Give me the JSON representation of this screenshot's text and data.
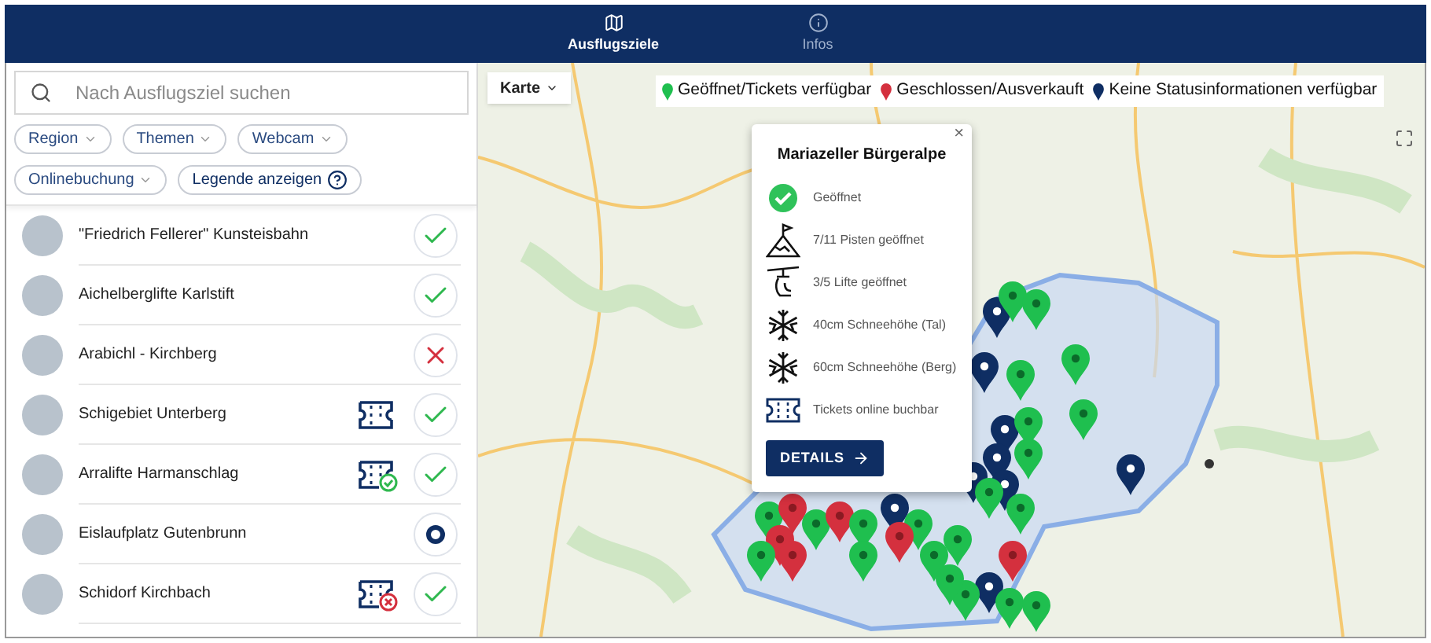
{
  "nav": {
    "tabs": [
      {
        "label": "Ausflugsziele",
        "kind": "map",
        "selected": true
      },
      {
        "label": "Infos",
        "kind": "info",
        "selected": false
      }
    ]
  },
  "search": {
    "placeholder": "Nach Ausflugsziel suchen"
  },
  "filters": [
    {
      "label": "Region",
      "kind": "dropdown"
    },
    {
      "label": "Themen",
      "kind": "dropdown"
    },
    {
      "label": "Webcam",
      "kind": "dropdown"
    },
    {
      "label": "Onlinebuchung",
      "kind": "dropdown"
    },
    {
      "label": "Legende anzeigen",
      "kind": "help"
    }
  ],
  "destinations": [
    {
      "name": "\"Friedrich Fellerer\" Kunsteisbahn",
      "status_icon": {
        "kind": "open"
      }
    },
    {
      "name": "Aichelberglifte Karlstift",
      "status_icon": {
        "kind": "open"
      }
    },
    {
      "name": "Arabichl - Kirchberg",
      "status_icon": {
        "kind": "closed"
      }
    },
    {
      "name": "Schigebiet Unterberg",
      "ticket_icon": {
        "kind": "plain"
      },
      "status_icon": {
        "kind": "open"
      }
    },
    {
      "name": "Arralifte Harmanschlag",
      "ticket_icon": {
        "kind": "available"
      },
      "status_icon": {
        "kind": "open"
      }
    },
    {
      "name": "Eislaufplatz Gutenbrunn",
      "status_icon": {
        "kind": "unknown"
      }
    },
    {
      "name": "Schidorf Kirchbach",
      "ticket_icon": {
        "kind": "sold_out"
      },
      "status_icon": {
        "kind": "open"
      }
    }
  ],
  "map": {
    "type_button": "Karte",
    "legend": [
      {
        "label": "Geöffnet/Tickets verfügbar",
        "color": "#1fbf4f"
      },
      {
        "label": "Geschlossen/Ausverkauft",
        "color": "#d4303e"
      },
      {
        "label": "Keine Statusinformationen verfügbar",
        "color": "#0f2e63"
      }
    ],
    "popup": {
      "title": "Mariazeller Bürgeralpe",
      "close": "×",
      "rows": [
        {
          "kind": "open",
          "text": "Geöffnet"
        },
        {
          "kind": "slope",
          "text": "7/11 Pisten geöffnet"
        },
        {
          "kind": "lift",
          "text": "3/5 Lifte geöffnet"
        },
        {
          "kind": "snow",
          "text": "40cm Schneehöhe (Tal)"
        },
        {
          "kind": "snow",
          "text": "60cm Schneehöhe (Berg)"
        },
        {
          "kind": "ticket",
          "text": "Tickets online buchbar"
        }
      ],
      "button": "DETAILS"
    }
  }
}
